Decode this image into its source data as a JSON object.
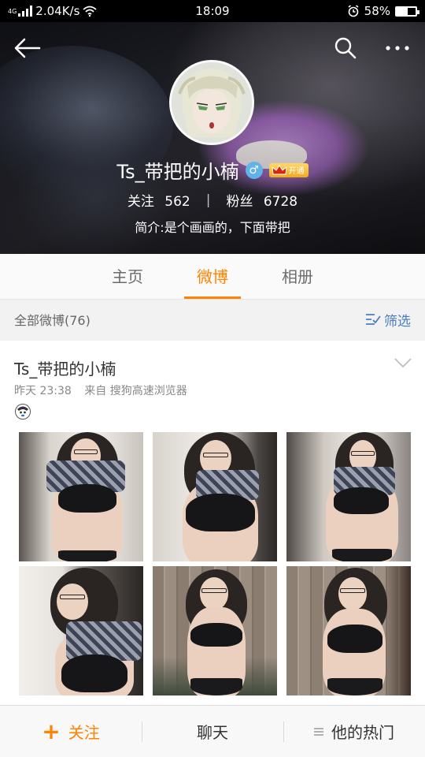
{
  "status_bar": {
    "network_tag": "4G",
    "speed": "2.04K/s",
    "time": "18:09",
    "battery": "58%",
    "battery_level": 0.58,
    "icons": [
      "signal-icon",
      "wifi-icon",
      "alarm-icon",
      "battery-icon"
    ]
  },
  "header": {
    "icons": [
      "back-icon",
      "search-icon",
      "more-icon"
    ],
    "username": "Ts_带把的小楠",
    "gender_symbol": "♂",
    "vip_label": "开通",
    "follow_label": "关注",
    "follow_count": "562",
    "fans_label": "粉丝",
    "fans_count": "6728",
    "stats_divider": "|",
    "bio": "简介:是个画画的，下面带把"
  },
  "tabs": [
    {
      "label": "主页",
      "active": false
    },
    {
      "label": "微博",
      "active": true
    },
    {
      "label": "相册",
      "active": false
    }
  ],
  "filter": {
    "title": "全部微博(76)",
    "button_label": "筛选"
  },
  "post": {
    "author": "Ts_带把的小楠",
    "time": "昨天 23:38",
    "source": "来自 搜狗高速浏览器",
    "photo_count": 6
  },
  "bottom_bar": {
    "follow_label": "关注",
    "chat_label": "聊天",
    "hot_label": "他的热门",
    "plus_symbol": "+"
  },
  "colors": {
    "accent": "#ff8200",
    "link": "#4b7dbf",
    "badge_blue": "#5fb2ea",
    "vip_gold": "#f2a71b"
  }
}
